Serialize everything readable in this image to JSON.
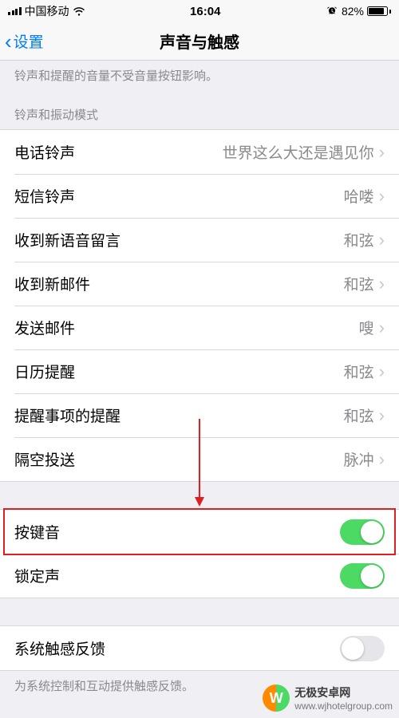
{
  "status_bar": {
    "carrier": "中国移动",
    "time": "16:04",
    "battery_pct": "82%"
  },
  "nav": {
    "back_label": "设置",
    "title": "声音与触感"
  },
  "hint_top": "铃声和提醒的音量不受音量按钮影响。",
  "section_ringtone_header": "铃声和振动模式",
  "sounds": [
    {
      "label": "电话铃声",
      "value": "世界这么大还是遇见你"
    },
    {
      "label": "短信铃声",
      "value": "哈喽"
    },
    {
      "label": "收到新语音留言",
      "value": "和弦"
    },
    {
      "label": "收到新邮件",
      "value": "和弦"
    },
    {
      "label": "发送邮件",
      "value": "嗖"
    },
    {
      "label": "日历提醒",
      "value": "和弦"
    },
    {
      "label": "提醒事项的提醒",
      "value": "和弦"
    },
    {
      "label": "隔空投送",
      "value": "脉冲"
    }
  ],
  "toggles": {
    "keyboard_clicks": {
      "label": "按键音",
      "on": true
    },
    "lock_sound": {
      "label": "锁定声",
      "on": true
    }
  },
  "haptics": {
    "label": "系统触感反馈",
    "on": false,
    "footer": "为系统控制和互动提供触感反馈。"
  },
  "watermark": {
    "brand": "无极安卓网",
    "url": "www.wjhotelgroup.com",
    "logo_letter": "W"
  }
}
